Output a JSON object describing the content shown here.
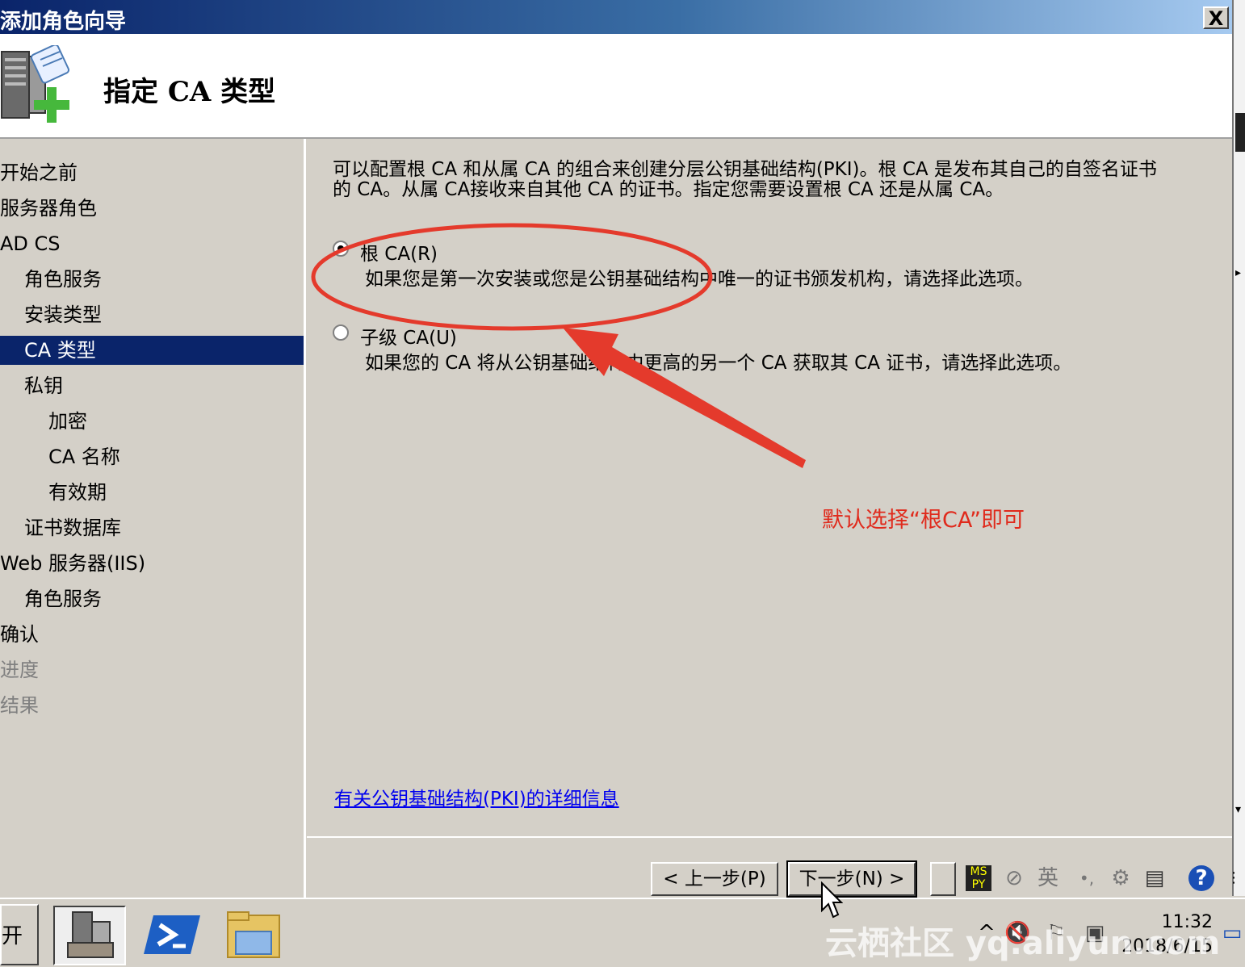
{
  "window": {
    "title": "添加角色向导",
    "close_label": "X"
  },
  "header": {
    "title": "指定 CA 类型"
  },
  "sidebar": {
    "items": [
      {
        "label": "开始之前",
        "state": "normal"
      },
      {
        "label": "服务器角色",
        "state": "normal"
      },
      {
        "label": "AD CS",
        "state": "normal"
      },
      {
        "label": "角色服务",
        "state": "normal"
      },
      {
        "label": "安装类型",
        "state": "normal"
      },
      {
        "label": "CA 类型",
        "state": "active"
      },
      {
        "label": "私钥",
        "state": "normal"
      },
      {
        "label": "加密",
        "state": "normal"
      },
      {
        "label": "CA 名称",
        "state": "normal"
      },
      {
        "label": "有效期",
        "state": "normal"
      },
      {
        "label": "证书数据库",
        "state": "normal"
      },
      {
        "label": "Web 服务器(IIS)",
        "state": "normal"
      },
      {
        "label": "角色服务",
        "state": "normal"
      },
      {
        "label": "确认",
        "state": "normal"
      },
      {
        "label": "进度",
        "state": "disabled"
      },
      {
        "label": "结果",
        "state": "disabled"
      }
    ]
  },
  "main": {
    "description_line1": "可以配置根 CA 和从属 CA 的组合来创建分层公钥基础结构(PKI)。根 CA 是发布其自己的自签名证书",
    "description_line2": "的 CA。从属 CA接收来自其他 CA 的证书。指定您需要设置根 CA 还是从属 CA。",
    "options": [
      {
        "label": "根 CA(R)",
        "description": "如果您是第一次安装或您是公钥基础结构中唯一的证书颁发机构，请选择此选项。",
        "selected": true
      },
      {
        "label": "子级 CA(U)",
        "description": "如果您的 CA 将从公钥基础结构中更高的另一个 CA 获取其 CA 证书，请选择此选项。",
        "selected": false
      }
    ],
    "link": "有关公钥基础结构(PKI)的详细信息"
  },
  "annotation": {
    "text": "默认选择“根CA”即可",
    "color": "#e02a1c"
  },
  "buttons": {
    "prev": "< 上一步(P)",
    "next": "下一步(N) >"
  },
  "ime": {
    "lang": "英"
  },
  "taskbar": {
    "start": "开始",
    "time": "11:32",
    "date": "2018/6/15"
  },
  "watermark": "云栖社区 yq.aliyun.com",
  "colors": {
    "titlebar": "#0a246a",
    "selection": "#0a246a",
    "annotation": "#e02a1c",
    "link": "#0000ee"
  }
}
